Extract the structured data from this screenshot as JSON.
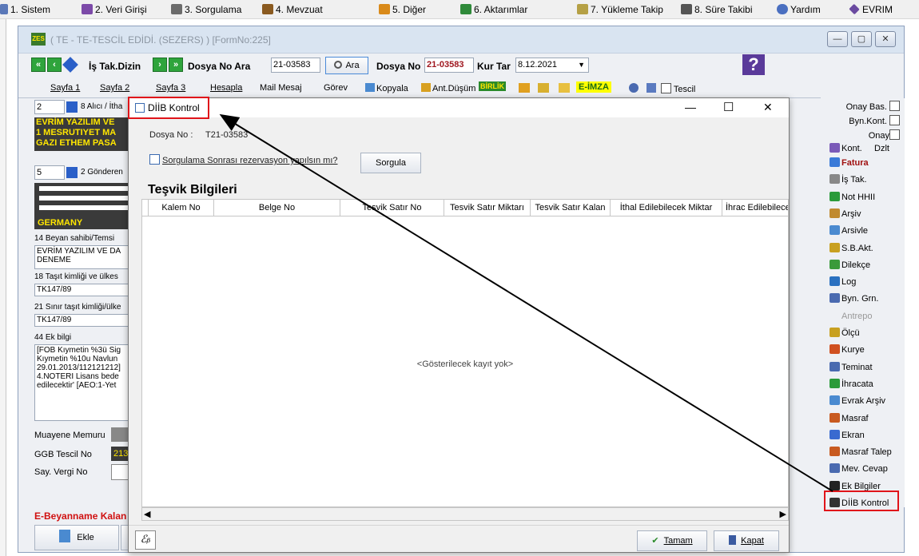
{
  "menubar": {
    "items": [
      {
        "label": "1. Sistem",
        "icon": "gear-icon",
        "color": "#5a78b8"
      },
      {
        "label": "2. Veri Girişi",
        "icon": "pen-icon",
        "color": "#7c4aa8"
      },
      {
        "label": "3. Sorgulama",
        "icon": "report-icon",
        "color": "#6b6b6b"
      },
      {
        "label": "4. Mevzuat",
        "icon": "books-icon",
        "color": "#8a5a20"
      },
      {
        "label": "5. Diğer",
        "icon": "tools-icon",
        "color": "#d98a1a"
      },
      {
        "label": "6. Aktarımlar",
        "icon": "transfer-icon",
        "color": "#2f8a3a"
      },
      {
        "label": "7. Yükleme Takip",
        "icon": "truck-icon",
        "color": "#b5a045"
      },
      {
        "label": "8. Süre Takibi",
        "icon": "calendar-icon",
        "color": "#555"
      },
      {
        "label": "Yardım",
        "icon": "help-icon",
        "color": "#4a6fc0"
      },
      {
        "label": "EVRIM",
        "icon": "diamond-icon",
        "color": "#6a4aa0"
      }
    ]
  },
  "window": {
    "title": "( TE  - TE-TESCİL EDİDİ. (SEZERS) ) [FormNo:225]",
    "logo_text": "ZES"
  },
  "toolbar": {
    "is_tak_dizin": "İş Tak.Dizin",
    "dosya_no_ara_label": "Dosya No Ara",
    "dosya_no_ara_value": "21-03583",
    "ara_button": "Ara",
    "dosya_no_label": "Dosya No",
    "dosya_no_value": "21-03583",
    "kur_tar_label": "Kur Tar",
    "kur_tar_value": "8.12.2021",
    "help_glyph": "?"
  },
  "tabs": [
    "Sayfa 1",
    "Sayfa 2",
    "Sayfa 3",
    "Hesapla",
    "Mail Mesaj",
    "Görev"
  ],
  "tabtools": {
    "kopyala": "Kopyala",
    "ant_dusum": "Ant.Düşüm",
    "birlik": "BİRLİK",
    "e_imza": "E-İMZA",
    "tescil": "Tescil"
  },
  "leftform": {
    "field1_value": "2",
    "field1_label": "8 Alıcı / İtha",
    "yellow_lines": [
      "EVRİM YAZILIM VE",
      "1 MESRUTIYET MA",
      "GAZI ETHEM PASA"
    ],
    "field2_value": "5",
    "field2_label": "2 Gönderen",
    "germany": "GERMANY",
    "beyan_label": "14 Beyan sahibi/Temsi",
    "beyan_lines": [
      "EVRİM YAZILIM VE DA",
      "DENEME"
    ],
    "tasit_label": "18 Taşıt kimliği ve ülkes",
    "tasit_value": "TK147/89",
    "sinir_label": "21 Sınır taşıt kimliği/ülke",
    "sinir_value": "TK147/89",
    "ekbilgi_label": "44 Ek bilgi",
    "ekbilgi_lines": [
      "[FOB Kıymetin %3ü Sig",
      "Kıymetin %10u Navlun",
      "29.01.2013/112121212]",
      "4.NOTERI Lisans bede",
      "edilecektir' [AEO:1-Yet"
    ],
    "muayene_label": "Muayene Memuru",
    "ggb_label": "GGB Tescil No",
    "ggb_value": "213",
    "say_vergi_label": "Say. Vergi No",
    "ebeyanname_label": "E-Beyanname Kalan"
  },
  "rightpanel": {
    "onay_bas": "Onay Bas.",
    "byn_kont": "Byn.Kont.",
    "onay": "Onay",
    "kont": "Kont.",
    "dzlt": "Dzlt",
    "items": [
      {
        "label": "Fatura",
        "icon": "invoice-icon",
        "color": "#3a7ad8",
        "bold": true
      },
      {
        "label": "İş Tak.",
        "icon": "list-icon",
        "color": "#888"
      },
      {
        "label": "Not HHII",
        "icon": "note-icon",
        "color": "#2a9a3a"
      },
      {
        "label": "Arşiv",
        "icon": "archive-icon",
        "color": "#c08a30"
      },
      {
        "label": "Arsivle",
        "icon": "archive-add-icon",
        "color": "#4a8ad0"
      },
      {
        "label": "S.B.Akt.",
        "icon": "transfer-icon",
        "color": "#c8a020"
      },
      {
        "label": "Dilekçe",
        "icon": "form-icon",
        "color": "#3a9a3a"
      },
      {
        "label": "Log",
        "icon": "log-icon",
        "color": "#2a70c0"
      },
      {
        "label": "Byn. Grn.",
        "icon": "doc-icon",
        "color": "#4a6ab0"
      },
      {
        "label": "Antrepo",
        "icon": "warehouse-icon",
        "color": "#aaa"
      },
      {
        "label": "Ölçü",
        "icon": "measure-icon",
        "color": "#c8a020"
      },
      {
        "label": "Kurye",
        "icon": "courier-icon",
        "color": "#d05020"
      },
      {
        "label": "Teminat",
        "icon": "pen-icon",
        "color": "#4a6ab0"
      },
      {
        "label": "İhracata",
        "icon": "export-icon",
        "color": "#2a9a3a"
      },
      {
        "label": "Evrak Arşiv",
        "icon": "document-icon",
        "color": "#4a8ad0"
      },
      {
        "label": "Masraf",
        "icon": "expense-icon",
        "color": "#c85a20"
      },
      {
        "label": "Ekran",
        "icon": "screen-icon",
        "color": "#3a6ad0"
      },
      {
        "label": "Masraf Talep",
        "icon": "expense-request-icon",
        "color": "#c85a20"
      },
      {
        "label": "Mev. Cevap",
        "icon": "reply-icon",
        "color": "#4a6ab0"
      },
      {
        "label": "Ek Bilgiler",
        "icon": "info-icon",
        "color": "#222"
      },
      {
        "label": "DİİB Kontrol",
        "icon": "control-icon",
        "color": "#333"
      }
    ]
  },
  "dialog": {
    "title": "DİİB Kontrol",
    "dosya_no_label": "Dosya No :",
    "dosya_no_value": "T21-03583",
    "checkbox_label": "Sorgulama Sonrası rezervasyon yapılsın mı?",
    "sorgula_button": "Sorgula",
    "section_title": "Teşvik Bilgileri",
    "columns": [
      "Kalem No",
      "Belge No",
      "Tesvik Satır No",
      "Tesvik Satır Miktarı",
      "Tesvik Satır Kalan",
      "İthal Edilebilecek Miktar",
      "İhrac Edilebilecek"
    ],
    "empty_text": "<Gösterilecek kayıt yok>",
    "tamam_button": "Tamam",
    "kapat_button": "Kapat",
    "minimize": "—",
    "maximize": "☐",
    "close": "✕"
  },
  "bottombar": {
    "ekle_button": "Ekle"
  }
}
